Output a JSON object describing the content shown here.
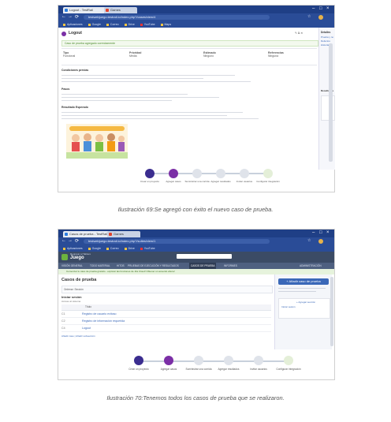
{
  "screenshot_1": {
    "tabs": [
      "Logout - TestRail",
      "Games"
    ],
    "url": "testwebjuego.testrail.io/index.php?/cases/view/4",
    "bookmarks": [
      "Aplicaciones",
      "Google",
      "Correo",
      "Drive",
      "YouTube",
      "Maps"
    ],
    "page_title": "Logout",
    "success_message": "Caso de prueba agregado correctamente",
    "fields": [
      {
        "label": "Tipo",
        "value": "Funcional"
      },
      {
        "label": "Prioridad",
        "value": "Media"
      },
      {
        "label": "Estimado",
        "value": "Ninguno"
      },
      {
        "label": "Referencias",
        "value": "Ninguna"
      }
    ],
    "sections": [
      "Condiciones previas",
      "Pasos",
      "Resultado Esperado"
    ],
    "side_panel": {
      "title": "Detalles",
      "items": [
        "Prueba y resultados",
        "Defectos",
        "Historial"
      ],
      "second_title": "Resultados Previos"
    },
    "steps": [
      "Crear un proyecto",
      "Agregar casos",
      "Suministrar una corrida",
      "Agregar resultados",
      "Invitar usuarios",
      "Configurar integración"
    ]
  },
  "caption_1": "Ilustración 69:Se agregó con éxito el nuevo caso de prueba.",
  "screenshot_2": {
    "tabs": [
      "Casos de prueba - TestRail",
      "Games"
    ],
    "url": "testwebjuego.testrail.io/index.php?/suites/view/1",
    "app_title": "Juego",
    "app_back": "Regresar al Tablero",
    "nav_tabs": [
      "VISIÓN GENERAL",
      "TODO MATERIAL",
      "HITOS",
      "PRUEBAS DE EJECUCIÓN Y RESULTADOS",
      "CASOS DE PRUEBA",
      "INFORMES"
    ],
    "admin_label": "ADMINISTRACIÓN",
    "banner": "Comenzar tu caso de prueba gratuito - explorar las funciones de Jira Cloud! Obtener un acuerdo ahora!",
    "page_title": "Casos de prueba",
    "filter_label": "Ordenar: Sección",
    "section_title": "Iniciar sesión",
    "section_subtitle": "Acceso al sistema",
    "column_title": "Título",
    "rows": [
      {
        "id": "C1",
        "title": "Registro de usuario exitoso"
      },
      {
        "id": "C2",
        "title": "Registro de información requerida"
      },
      {
        "id": "C4",
        "title": "Logout"
      }
    ],
    "footer_links": "Añadir caso | Añadir subsección",
    "add_case_button": "+ Añadir caso de prueba",
    "add_section_button": "+ Agregar sección",
    "steps": [
      "Crear un proyecto",
      "Agregar casos",
      "Suministrar una corrida",
      "Agregar resultados",
      "Invitar usuarios",
      "Configurar integración"
    ]
  },
  "caption_2": "Ilustración 70:Tenemos todos los casos de prueba que se realizaron.",
  "colors": {
    "browser_chrome": "#2a4c97",
    "success": "#6cb33f",
    "purple_accent": "#7b2fa6",
    "testrail_header": "#3b4b65"
  }
}
